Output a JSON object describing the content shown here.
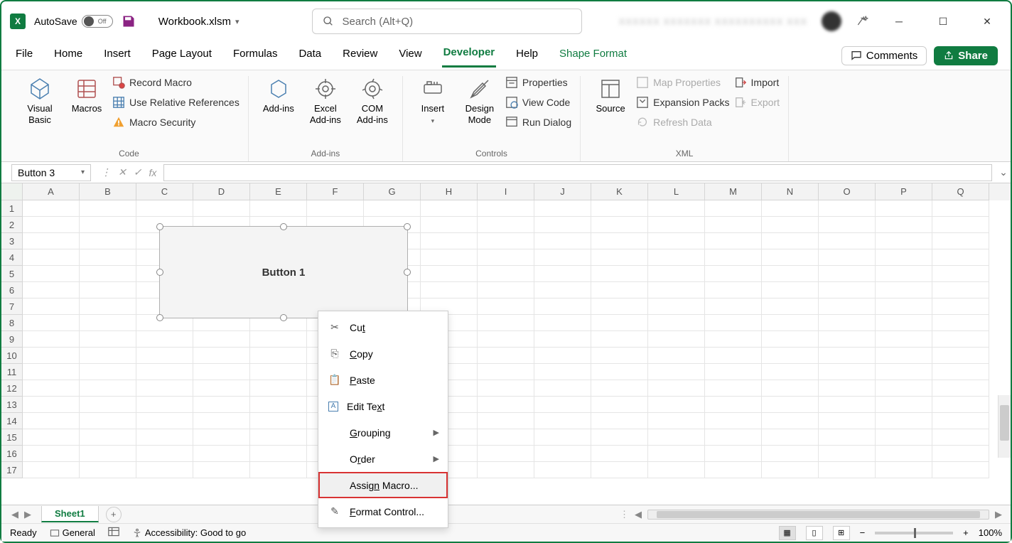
{
  "titlebar": {
    "autosave_label": "AutoSave",
    "autosave_state": "Off",
    "workbook_name": "Workbook.xlsm",
    "search_placeholder": "Search (Alt+Q)",
    "user_blurred": "XXXXXX XXXXXXX XXXXXXXXXX  XXX"
  },
  "tabs": {
    "file": "File",
    "home": "Home",
    "insert": "Insert",
    "page_layout": "Page Layout",
    "formulas": "Formulas",
    "data": "Data",
    "review": "Review",
    "view": "View",
    "developer": "Developer",
    "help": "Help",
    "shape_format": "Shape Format",
    "comments": "Comments",
    "share": "Share"
  },
  "ribbon": {
    "code": {
      "visual_basic": "Visual Basic",
      "macros": "Macros",
      "record_macro": "Record Macro",
      "use_relative": "Use Relative References",
      "macro_security": "Macro Security",
      "label": "Code"
    },
    "addins": {
      "addins": "Add-ins",
      "excel_addins": "Excel Add-ins",
      "com_addins": "COM Add-ins",
      "label": "Add-ins"
    },
    "controls": {
      "insert": "Insert",
      "design_mode": "Design Mode",
      "properties": "Properties",
      "view_code": "View Code",
      "run_dialog": "Run Dialog",
      "label": "Controls"
    },
    "xml": {
      "source": "Source",
      "map_properties": "Map Properties",
      "expansion_packs": "Expansion Packs",
      "refresh_data": "Refresh Data",
      "import": "Import",
      "export": "Export",
      "label": "XML"
    }
  },
  "formula_bar": {
    "name_box": "Button 3",
    "fx": "fx"
  },
  "columns": [
    "A",
    "B",
    "C",
    "D",
    "E",
    "F",
    "G",
    "H",
    "I",
    "J",
    "K",
    "L",
    "M",
    "N",
    "O",
    "P",
    "Q"
  ],
  "rows": [
    "1",
    "2",
    "3",
    "4",
    "5",
    "6",
    "7",
    "8",
    "9",
    "10",
    "11",
    "12",
    "13",
    "14",
    "15",
    "16",
    "17"
  ],
  "shape": {
    "label": "Button 1"
  },
  "context_menu": {
    "cut": "Cut",
    "copy": "Copy",
    "paste": "Paste",
    "edit_text": "Edit Text",
    "grouping": "Grouping",
    "order": "Order",
    "assign_macro": "Assign Macro...",
    "format_control": "Format Control..."
  },
  "sheet_tabs": {
    "sheet1": "Sheet1"
  },
  "status": {
    "ready": "Ready",
    "general": "General",
    "accessibility": "Accessibility: Good to go",
    "zoom": "100%"
  }
}
